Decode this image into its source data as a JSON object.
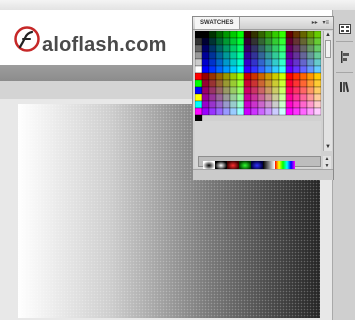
{
  "site": {
    "name": "aloflash.com"
  },
  "swatches": {
    "title": "SWATCHES",
    "header_icons": [
      "expand-icon",
      "panel-menu-icon"
    ],
    "scroll_up": "▲",
    "scroll_down": "▼"
  },
  "dock": {
    "icons": [
      "swatches-dock-icon",
      "align-dock-icon",
      "library-dock-icon"
    ]
  }
}
